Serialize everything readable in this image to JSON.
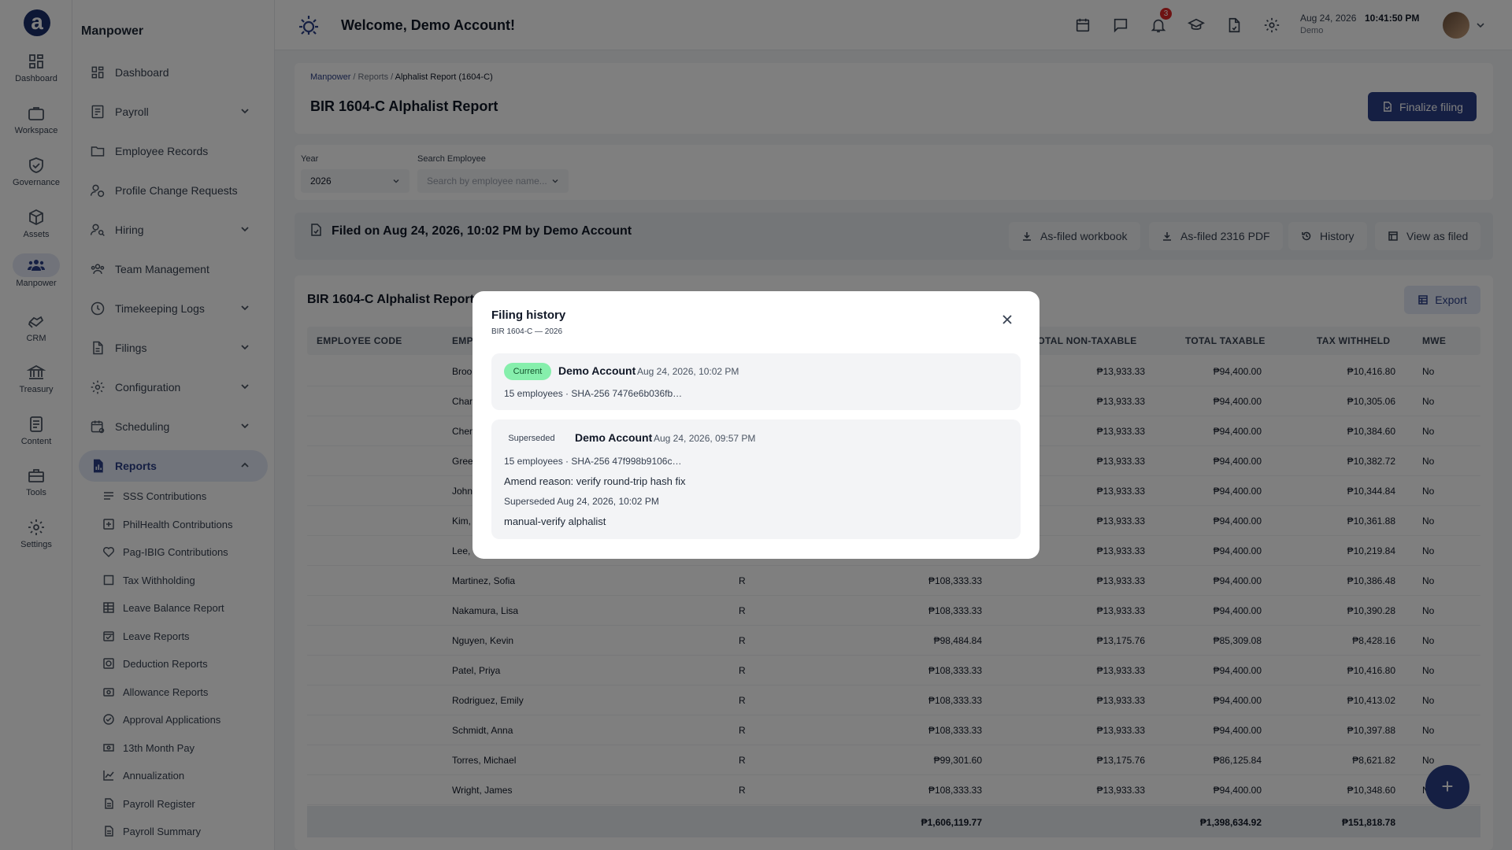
{
  "rail": [
    {
      "label": "Dashboard",
      "icon": "grid-icon"
    },
    {
      "label": "Workspace",
      "icon": "briefcase-icon"
    },
    {
      "label": "Governance",
      "icon": "shield-icon"
    },
    {
      "label": "Assets",
      "icon": "cube-icon"
    },
    {
      "label": "Manpower",
      "icon": "people-icon"
    },
    {
      "label": "CRM",
      "icon": "handshake-icon"
    },
    {
      "label": "Treasury",
      "icon": "bank-icon"
    },
    {
      "label": "Content",
      "icon": "document-icon"
    },
    {
      "label": "Tools",
      "icon": "toolbox-icon"
    },
    {
      "label": "Settings",
      "icon": "gear-icon"
    }
  ],
  "nav": {
    "title": "Manpower",
    "items": [
      {
        "label": "Dashboard",
        "icon": "grid-icon"
      },
      {
        "label": "Payroll",
        "icon": "receipt-icon",
        "chevron": "down"
      },
      {
        "label": "Employee Records",
        "icon": "folder-icon"
      },
      {
        "label": "Profile Change Requests",
        "icon": "user-edit-icon"
      },
      {
        "label": "Hiring",
        "icon": "user-search-icon",
        "chevron": "down"
      },
      {
        "label": "Team Management",
        "icon": "team-icon"
      },
      {
        "label": "Timekeeping Logs",
        "icon": "clock-icon",
        "chevron": "down"
      },
      {
        "label": "Filings",
        "icon": "file-icon",
        "chevron": "down"
      },
      {
        "label": "Configuration",
        "icon": "gear-icon",
        "chevron": "down"
      },
      {
        "label": "Scheduling",
        "icon": "calendar-clock-icon",
        "chevron": "down"
      },
      {
        "label": "Reports",
        "icon": "report-icon",
        "chevron": "up"
      }
    ],
    "sub_items": [
      {
        "label": "SSS Contributions",
        "icon": "list-icon"
      },
      {
        "label": "PhilHealth Contributions",
        "icon": "medical-icon"
      },
      {
        "label": "Pag-IBIG Contributions",
        "icon": "heart-icon"
      },
      {
        "label": "Tax Withholding",
        "icon": "square-icon"
      },
      {
        "label": "Leave Balance Report",
        "icon": "table-icon"
      },
      {
        "label": "Leave Reports",
        "icon": "calendar-check-icon"
      },
      {
        "label": "Deduction Reports",
        "icon": "deduction-icon"
      },
      {
        "label": "Allowance Reports",
        "icon": "allowance-icon"
      },
      {
        "label": "Approval Applications",
        "icon": "check-circle-icon"
      },
      {
        "label": "13th Month Pay",
        "icon": "money-icon"
      },
      {
        "label": "Annualization",
        "icon": "chart-line-icon"
      },
      {
        "label": "Payroll Register",
        "icon": "doc-icon"
      },
      {
        "label": "Payroll Summary",
        "icon": "doc-icon"
      }
    ]
  },
  "header": {
    "welcome": "Welcome, Demo Account!",
    "notification_count": "3",
    "date": "Aug 24, 2026",
    "time": "10:41:50 PM",
    "user": "Demo"
  },
  "page": {
    "breadcrumb": [
      "Manpower",
      "Reports",
      "Alphalist Report (1604-C)"
    ],
    "title": "BIR 1604-C Alphalist Report",
    "finalize_label": "Finalize filing",
    "year_label": "Year",
    "year_value": "2026",
    "search_label": "Search Employee",
    "search_placeholder": "Search by employee name...",
    "filed_text": "Filed on Aug 24, 2026, 10:02 PM by Demo Account",
    "actions": [
      "As-filed workbook",
      "As-filed 2316 PDF",
      "History",
      "View as filed"
    ],
    "section_title": "BIR 1604-C Alphalist Report",
    "export_label": "Export",
    "columns": [
      "EMPLOYEE CODE",
      "EMP",
      "TOTAL NON-TAXABLE",
      "TOTAL TAXABLE",
      "TAX WITHHELD",
      "MWE"
    ],
    "rows": [
      {
        "name": "Broo",
        "type": "",
        "gross": "",
        "nontax": "₱13,933.33",
        "taxable": "₱94,400.00",
        "withheld": "₱10,416.80",
        "mwe": "No"
      },
      {
        "name": "Char",
        "type": "",
        "gross": "",
        "nontax": "₱13,933.33",
        "taxable": "₱94,400.00",
        "withheld": "₱10,305.06",
        "mwe": "No"
      },
      {
        "name": "Chen",
        "type": "",
        "gross": "",
        "nontax": "₱13,933.33",
        "taxable": "₱94,400.00",
        "withheld": "₱10,384.60",
        "mwe": "No"
      },
      {
        "name": "Gree",
        "type": "",
        "gross": "",
        "nontax": "₱13,933.33",
        "taxable": "₱94,400.00",
        "withheld": "₱10,382.72",
        "mwe": "No"
      },
      {
        "name": "John",
        "type": "",
        "gross": "",
        "nontax": "₱13,933.33",
        "taxable": "₱94,400.00",
        "withheld": "₱10,344.84",
        "mwe": "No"
      },
      {
        "name": "Kim,",
        "type": "",
        "gross": "",
        "nontax": "₱13,933.33",
        "taxable": "₱94,400.00",
        "withheld": "₱10,361.88",
        "mwe": "No"
      },
      {
        "name": "Lee,",
        "type": "",
        "gross": "",
        "nontax": "₱13,933.33",
        "taxable": "₱94,400.00",
        "withheld": "₱10,219.84",
        "mwe": "No"
      },
      {
        "name": "Martinez, Sofia",
        "type": "R",
        "gross": "₱108,333.33",
        "nontax": "₱13,933.33",
        "taxable": "₱94,400.00",
        "withheld": "₱10,386.48",
        "mwe": "No"
      },
      {
        "name": "Nakamura, Lisa",
        "type": "R",
        "gross": "₱108,333.33",
        "nontax": "₱13,933.33",
        "taxable": "₱94,400.00",
        "withheld": "₱10,390.28",
        "mwe": "No"
      },
      {
        "name": "Nguyen, Kevin",
        "type": "R",
        "gross": "₱98,484.84",
        "nontax": "₱13,175.76",
        "taxable": "₱85,309.08",
        "withheld": "₱8,428.16",
        "mwe": "No"
      },
      {
        "name": "Patel, Priya",
        "type": "R",
        "gross": "₱108,333.33",
        "nontax": "₱13,933.33",
        "taxable": "₱94,400.00",
        "withheld": "₱10,416.80",
        "mwe": "No"
      },
      {
        "name": "Rodriguez, Emily",
        "type": "R",
        "gross": "₱108,333.33",
        "nontax": "₱13,933.33",
        "taxable": "₱94,400.00",
        "withheld": "₱10,413.02",
        "mwe": "No"
      },
      {
        "name": "Schmidt, Anna",
        "type": "R",
        "gross": "₱108,333.33",
        "nontax": "₱13,933.33",
        "taxable": "₱94,400.00",
        "withheld": "₱10,397.88",
        "mwe": "No"
      },
      {
        "name": "Torres, Michael",
        "type": "R",
        "gross": "₱99,301.60",
        "nontax": "₱13,175.76",
        "taxable": "₱86,125.84",
        "withheld": "₱8,621.82",
        "mwe": "No"
      },
      {
        "name": "Wright, James",
        "type": "R",
        "gross": "₱108,333.33",
        "nontax": "₱13,933.33",
        "taxable": "₱94,400.00",
        "withheld": "₱10,348.60",
        "mwe": "No"
      }
    ],
    "totals": {
      "gross": "₱1,606,119.77",
      "taxable": "₱1,398,634.92",
      "withheld": "₱151,818.78"
    }
  },
  "modal": {
    "title": "Filing history",
    "subtitle": "BIR 1604-C — 2026",
    "current": {
      "tag": "Current",
      "name": "Demo Account",
      "time": "Aug 24, 2026, 10:02 PM",
      "meta": "15 employees · SHA-256 7476e6b036fb…"
    },
    "superseded": {
      "tag": "Superseded",
      "name": "Demo Account",
      "time": "Aug 24, 2026, 09:57 PM",
      "meta": "15 employees · SHA-256 47f998b9106c…",
      "reason": "Amend reason: verify round-trip hash fix",
      "superseded_at": "Superseded Aug 24, 2026, 10:02 PM",
      "note": "manual-verify alphalist"
    }
  },
  "colors": {
    "primary": "#2b3f86",
    "current_tag": "#86efac",
    "badge": "#dc2626"
  }
}
